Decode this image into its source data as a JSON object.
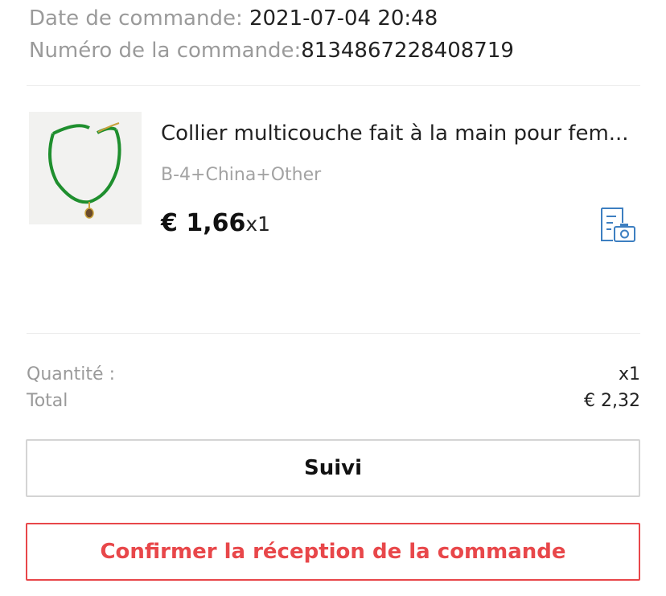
{
  "order": {
    "date_label": "Date de commande:",
    "date_value": "2021-07-04 20:48",
    "number_label": "Numéro de la commande:",
    "number_value": "8134867228408719"
  },
  "product": {
    "title": "Collier multicouche fait à la main pour fem...",
    "variant": "B-4+China+Other",
    "price": "€ 1,66",
    "quantity": "x1",
    "image_icon": "necklace-product-image",
    "action_icon": "photo-review-icon"
  },
  "summary": {
    "quantity_label": "Quantité :",
    "quantity_value": "x1",
    "total_label": "Total",
    "total_value": "€ 2,32"
  },
  "buttons": {
    "track_label": "Suivi",
    "confirm_label": "Confirmer la réception de la commande"
  },
  "colors": {
    "accent": "#e8474a",
    "icon_blue": "#3d7fc1",
    "muted_text": "#9a9a9a",
    "necklace_green": "#1f8f2e"
  }
}
